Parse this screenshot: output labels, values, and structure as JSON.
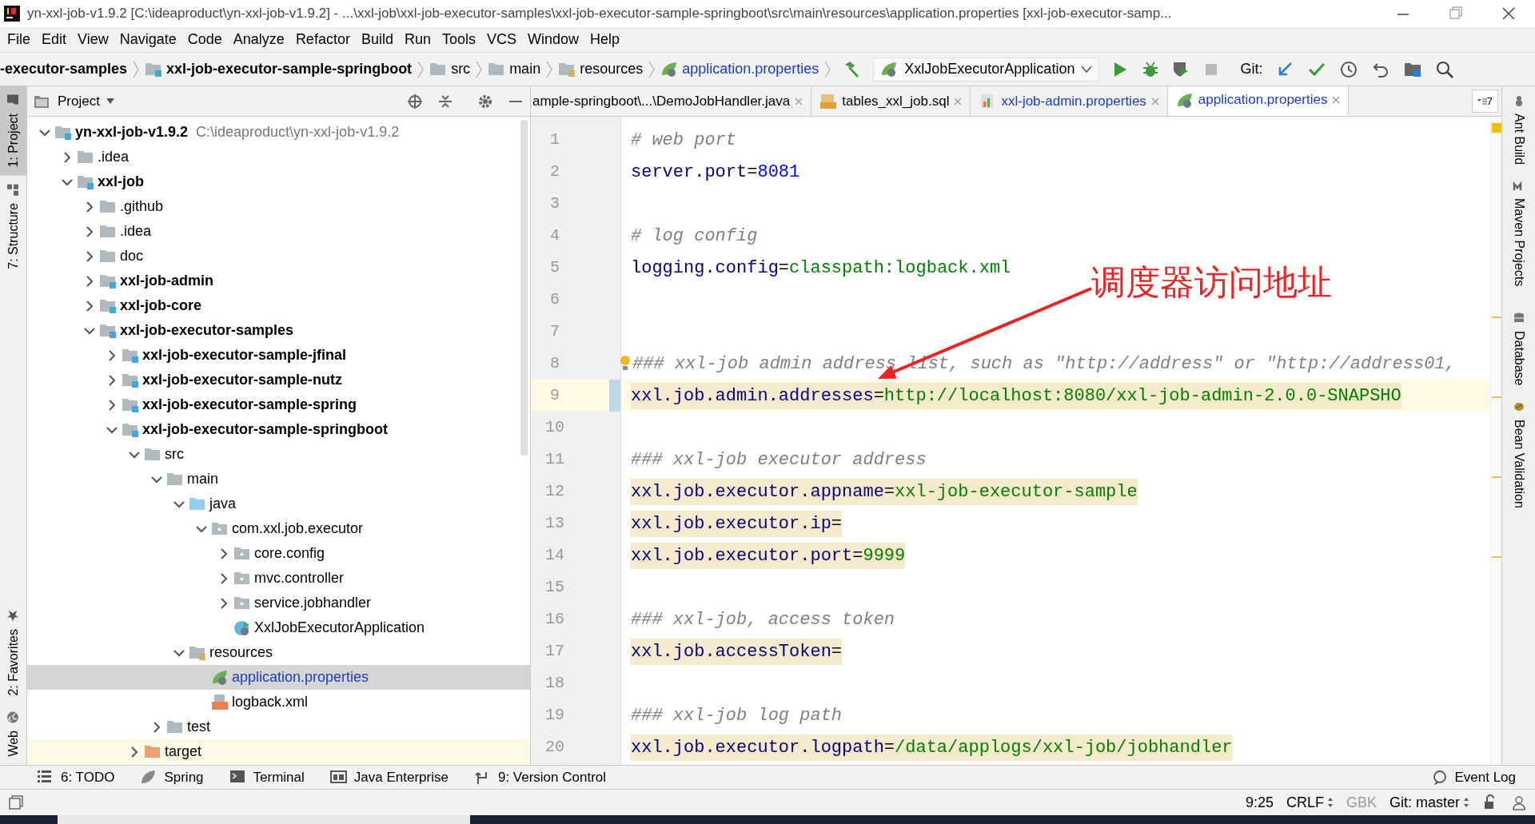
{
  "window": {
    "title": "yn-xxl-job-v1.9.2 [C:\\ideaproduct\\yn-xxl-job-v1.9.2] - ...\\xxl-job\\xxl-job-executor-samples\\xxl-job-executor-sample-springboot\\src\\main\\resources\\application.properties [xxl-job-executor-samp..."
  },
  "menu": [
    "File",
    "Edit",
    "View",
    "Navigate",
    "Code",
    "Analyze",
    "Refactor",
    "Build",
    "Run",
    "Tools",
    "VCS",
    "Window",
    "Help"
  ],
  "breadcrumbs": [
    {
      "label": "-executor-samples",
      "kind": "module"
    },
    {
      "label": "xxl-job-executor-sample-springboot",
      "kind": "module"
    },
    {
      "label": "src",
      "kind": "folder"
    },
    {
      "label": "main",
      "kind": "folder"
    },
    {
      "label": "resources",
      "kind": "resources"
    },
    {
      "label": "application.properties",
      "kind": "properties"
    }
  ],
  "run_config": {
    "label": "XxlJobExecutorApplication"
  },
  "git_label": "Git:",
  "project_panel": {
    "title": "Project",
    "tree": [
      {
        "label": "yn-xxl-job-v1.9.2",
        "path": "C:\\ideaproduct\\yn-xxl-job-v1.9.2",
        "kind": "module",
        "expanded": true,
        "selected": false,
        "children": [
          {
            "label": ".idea",
            "kind": "folder",
            "expanded": false,
            "selected": false
          },
          {
            "label": "xxl-job",
            "kind": "module",
            "expanded": true,
            "selected": false,
            "children": [
              {
                "label": ".github",
                "kind": "folder",
                "expanded": false,
                "selected": false
              },
              {
                "label": ".idea",
                "kind": "folder",
                "expanded": false,
                "selected": false
              },
              {
                "label": "doc",
                "kind": "folder",
                "expanded": false,
                "selected": false
              },
              {
                "label": "xxl-job-admin",
                "kind": "module",
                "expanded": false,
                "selected": false
              },
              {
                "label": "xxl-job-core",
                "kind": "module",
                "expanded": false,
                "selected": false
              },
              {
                "label": "xxl-job-executor-samples",
                "kind": "module",
                "expanded": true,
                "selected": false,
                "children": [
                  {
                    "label": "xxl-job-executor-sample-jfinal",
                    "kind": "module",
                    "expanded": false,
                    "selected": false
                  },
                  {
                    "label": "xxl-job-executor-sample-nutz",
                    "kind": "module",
                    "expanded": false,
                    "selected": false
                  },
                  {
                    "label": "xxl-job-executor-sample-spring",
                    "kind": "module",
                    "expanded": false,
                    "selected": false
                  },
                  {
                    "label": "xxl-job-executor-sample-springboot",
                    "kind": "module",
                    "expanded": true,
                    "selected": false,
                    "children": [
                      {
                        "label": "src",
                        "kind": "folder",
                        "expanded": true,
                        "selected": false,
                        "children": [
                          {
                            "label": "main",
                            "kind": "folder",
                            "expanded": true,
                            "selected": false,
                            "children": [
                              {
                                "label": "java",
                                "kind": "source",
                                "expanded": true,
                                "selected": false,
                                "children": [
                                  {
                                    "label": "com.xxl.job.executor",
                                    "kind": "package",
                                    "expanded": true,
                                    "selected": false,
                                    "children": [
                                      {
                                        "label": "core.config",
                                        "kind": "package",
                                        "expanded": false,
                                        "selected": false
                                      },
                                      {
                                        "label": "mvc.controller",
                                        "kind": "package",
                                        "expanded": false,
                                        "selected": false
                                      },
                                      {
                                        "label": "service.jobhandler",
                                        "kind": "package",
                                        "expanded": false,
                                        "selected": false
                                      },
                                      {
                                        "label": "XxlJobExecutorApplication",
                                        "kind": "spring-class",
                                        "selected": false
                                      }
                                    ]
                                  }
                                ]
                              },
                              {
                                "label": "resources",
                                "kind": "resources",
                                "expanded": true,
                                "selected": false,
                                "children": [
                                  {
                                    "label": "application.properties",
                                    "kind": "properties",
                                    "selected": true
                                  },
                                  {
                                    "label": "logback.xml",
                                    "kind": "xml",
                                    "selected": false
                                  }
                                ]
                              }
                            ]
                          },
                          {
                            "label": "test",
                            "kind": "folder",
                            "expanded": false,
                            "selected": false
                          }
                        ]
                      },
                      {
                        "label": "target",
                        "kind": "excluded",
                        "expanded": false,
                        "selected": false
                      }
                    ]
                  }
                ]
              }
            ]
          }
        ]
      }
    ]
  },
  "editor": {
    "tabs": [
      {
        "label": "ample-springboot\\...\\DemoJobHandler.java",
        "kind": "java",
        "selected": false
      },
      {
        "label": "tables_xxl_job.sql",
        "kind": "sql",
        "selected": false
      },
      {
        "label": "xxl-job-admin.properties",
        "kind": "admin-properties",
        "selected": false
      },
      {
        "label": "application.properties",
        "kind": "properties",
        "selected": true
      }
    ],
    "tab_overflow": "7",
    "lines": [
      {
        "number": "1",
        "kind": "comment",
        "text": "# web port",
        "current": false
      },
      {
        "number": "2",
        "kind": "number-property",
        "key": "server.port",
        "separator": "=",
        "value": "8081",
        "highlighted": false,
        "current": false
      },
      {
        "number": "3",
        "kind": "blank",
        "current": false
      },
      {
        "number": "4",
        "kind": "comment",
        "text": "# log config",
        "current": false
      },
      {
        "number": "5",
        "kind": "string-property",
        "key": "logging.config",
        "separator": "=",
        "value": "classpath:logback.xml",
        "highlighted": false,
        "current": false
      },
      {
        "number": "6",
        "kind": "blank",
        "current": false
      },
      {
        "number": "7",
        "kind": "blank",
        "current": false
      },
      {
        "number": "8",
        "kind": "comment",
        "text": "### xxl-job admin address list, such as \"http://address\" or \"http://address01,",
        "current": false
      },
      {
        "number": "9",
        "kind": "string-property",
        "key": "xxl.job.admin.addresses",
        "separator": "=",
        "value": "http://localhost:8080/xxl-job-admin-2.0.0-SNAPSHO",
        "highlighted": true,
        "current": true
      },
      {
        "number": "10",
        "kind": "blank",
        "current": false
      },
      {
        "number": "11",
        "kind": "comment",
        "text": "### xxl-job executor address",
        "current": false
      },
      {
        "number": "12",
        "kind": "string-property",
        "key": "xxl.job.executor.appname",
        "separator": "=",
        "value": "xxl-job-executor-sample",
        "highlighted": true,
        "current": false
      },
      {
        "number": "13",
        "kind": "string-property",
        "key": "xxl.job.executor.ip",
        "separator": "=",
        "highlighted": true,
        "current": false
      },
      {
        "number": "14",
        "kind": "string-property",
        "key": "xxl.job.executor.port",
        "separator": "=",
        "value": "9999",
        "highlighted": true,
        "current": false
      },
      {
        "number": "15",
        "kind": "blank",
        "current": false
      },
      {
        "number": "16",
        "kind": "comment",
        "text": "### xxl-job, access token",
        "current": false
      },
      {
        "number": "17",
        "kind": "string-property",
        "key": "xxl.job.accessToken",
        "separator": "=",
        "highlighted": true,
        "current": false
      },
      {
        "number": "18",
        "kind": "blank",
        "current": false
      },
      {
        "number": "19",
        "kind": "comment",
        "text": "### xxl-job log path",
        "current": false
      },
      {
        "number": "20",
        "kind": "string-property",
        "key": "xxl.job.executor.logpath",
        "separator": "=",
        "value": "/data/applogs/xxl-job/jobhandler",
        "highlighted": true,
        "current": false
      }
    ]
  },
  "annotation": {
    "text": "调度器访问地址"
  },
  "left_strip_top": [
    {
      "label": "1: Project",
      "selected": true
    },
    {
      "label": "7: Structure",
      "selected": false
    }
  ],
  "left_strip_bottom": [
    {
      "label": "2: Favorites",
      "selected": false
    },
    {
      "label": "Web",
      "selected": false
    }
  ],
  "right_strip": [
    "Ant Build",
    "Maven Projects",
    "Database",
    "Bean Validation"
  ],
  "tool_windows": [
    {
      "label": "6: TODO",
      "kind": "todo"
    },
    {
      "label": "Spring",
      "kind": "spring"
    },
    {
      "label": "Terminal",
      "kind": "terminal"
    },
    {
      "label": "Java Enterprise",
      "kind": "javaee"
    },
    {
      "label": "9: Version Control",
      "kind": "vcs"
    }
  ],
  "event_log": "Event Log",
  "status": {
    "position": "9:25",
    "line_separator": "CRLF",
    "encoding": "GBK",
    "branch": "Git: master"
  }
}
